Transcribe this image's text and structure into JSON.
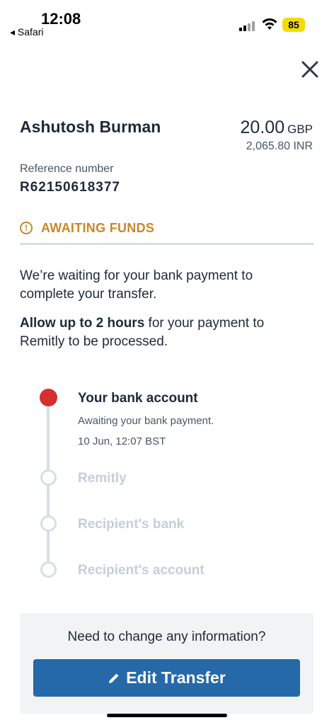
{
  "status_bar": {
    "time": "12:08",
    "back_app": "◂ Safari",
    "battery": "85"
  },
  "transfer": {
    "recipient_name": "Ashutosh Burman",
    "amount": "20.00",
    "amount_currency": "GBP",
    "converted_amount": "2,065.80 INR",
    "reference_label": "Reference number",
    "reference_number": "R62150618377"
  },
  "status": {
    "label": "AWAITING FUNDS",
    "icon": "warning-circle-icon",
    "color": "#c9872a"
  },
  "messages": {
    "waiting": "We’re waiting for your bank payment to complete your transfer.",
    "allow_bold": "Allow up to 2 hours",
    "allow_rest": " for your payment to Remitly to be processed."
  },
  "timeline": {
    "steps": [
      {
        "title": "Your bank account",
        "desc": "Awaiting your bank payment.",
        "timestamp": "10 Jun, 12:07 BST",
        "state": "active"
      },
      {
        "title": "Remitly",
        "state": "pending"
      },
      {
        "title": "Recipient's bank",
        "state": "pending"
      },
      {
        "title": "Recipient's account",
        "state": "pending"
      }
    ]
  },
  "change_card": {
    "question": "Need to change any information?",
    "button_label": "Edit Transfer"
  },
  "colors": {
    "accent": "#2569a8",
    "active_dot": "#d62f2f",
    "inactive": "#c5ced8"
  }
}
